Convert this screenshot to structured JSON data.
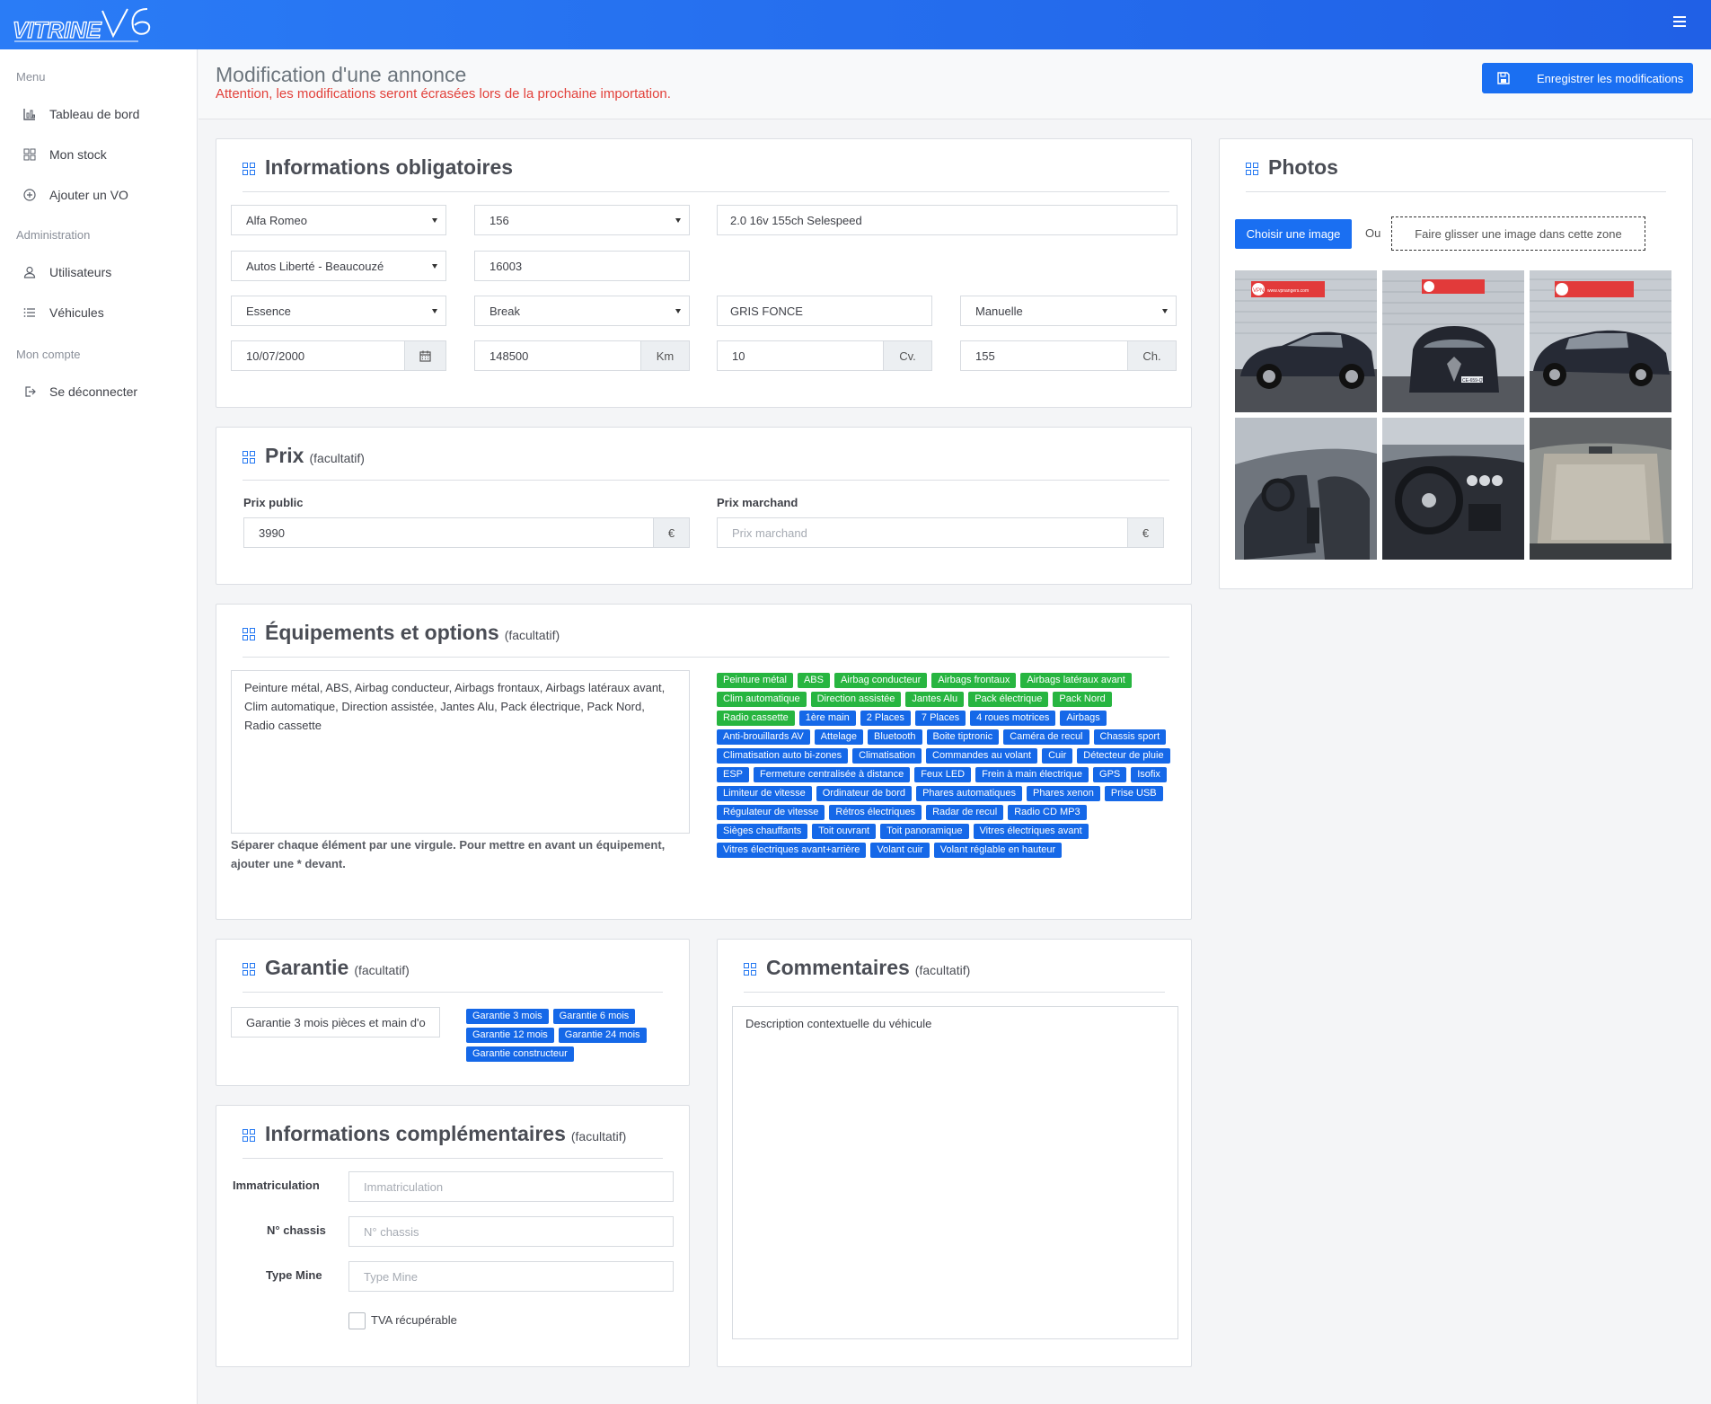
{
  "topbar": {
    "logo_text": "VITRINE",
    "logo_version": "V6"
  },
  "sidebar": {
    "sections": {
      "menu": "Menu",
      "admin": "Administration",
      "account": "Mon compte"
    },
    "items": [
      {
        "label": "Tableau de bord",
        "icon": "bar-chart-icon"
      },
      {
        "label": "Mon stock",
        "icon": "grid-icon"
      },
      {
        "label": "Ajouter un VO",
        "icon": "plus-circle-icon"
      },
      {
        "label": "Utilisateurs",
        "icon": "user-icon"
      },
      {
        "label": "Véhicules",
        "icon": "list-icon"
      },
      {
        "label": "Se déconnecter",
        "icon": "logout-icon"
      }
    ]
  },
  "header": {
    "title": "Modification d'une annonce",
    "warning": "Attention, les modifications seront écrasées lors de la prochaine importation.",
    "save_label": "Enregistrer les modifications"
  },
  "mandatory": {
    "title": "Informations obligatoires",
    "brand": "Alfa Romeo",
    "model": "156",
    "version": "2.0 16v 155ch Selespeed",
    "dealer": "Autos Liberté - Beaucouzé",
    "zip": "16003",
    "fuel": "Essence",
    "body": "Break",
    "color": "GRIS FONCE",
    "gearbox": "Manuelle",
    "date": "10/07/2000",
    "mileage": "148500",
    "mileage_unit": "Km",
    "fiscal_power": "10",
    "fiscal_unit": "Cv.",
    "power": "155",
    "power_unit": "Ch."
  },
  "price": {
    "title": "Prix",
    "optional": "(facultatif)",
    "public_label": "Prix public",
    "public_value": "3990",
    "merchant_label": "Prix marchand",
    "merchant_placeholder": "Prix marchand",
    "currency": "€"
  },
  "equipment": {
    "title": "Équipements et options",
    "optional": "(facultatif)",
    "text": "Peinture métal, ABS, Airbag conducteur, Airbags frontaux, Airbags latéraux avant, Clim automatique, Direction assistée, Jantes Alu, Pack électrique, Pack Nord, Radio cassette",
    "help": "Séparer chaque élément par une virgule. Pour mettre en avant un équipement, ajouter une * devant.",
    "selected_tags": [
      "Peinture métal",
      "ABS",
      "Airbag conducteur",
      "Airbags frontaux",
      "Airbags latéraux avant",
      "Clim automatique",
      "Direction assistée",
      "Jantes Alu",
      "Pack électrique",
      "Pack Nord",
      "Radio cassette"
    ],
    "available_tags": [
      "1ère main",
      "2 Places",
      "7 Places",
      "4 roues motrices",
      "Airbags",
      "Anti-brouillards AV",
      "Attelage",
      "Bluetooth",
      "Boite tiptronic",
      "Caméra de recul",
      "Chassis sport",
      "Climatisation auto bi-zones",
      "Climatisation",
      "Commandes au volant",
      "Cuir",
      "Détecteur de pluie",
      "ESP",
      "Fermeture centralisée à distance",
      "Feux LED",
      "Frein à main électrique",
      "GPS",
      "Isofix",
      "Limiteur de vitesse",
      "Ordinateur de bord",
      "Phares automatiques",
      "Phares xenon",
      "Prise USB",
      "Régulateur de vitesse",
      "Rétros électriques",
      "Radar de recul",
      "Radio CD MP3",
      "Sièges chauffants",
      "Toit ouvrant",
      "Toit panoramique",
      "Vitres électriques avant",
      "Vitres électriques avant+arrière",
      "Volant cuir",
      "Volant réglable en hauteur"
    ]
  },
  "warranty": {
    "title": "Garantie",
    "optional": "(facultatif)",
    "value": "Garantie 3 mois pièces et main d'o",
    "tags": [
      "Garantie 3 mois",
      "Garantie 6 mois",
      "Garantie 12 mois",
      "Garantie 24 mois",
      "Garantie constructeur"
    ]
  },
  "comments": {
    "title": "Commentaires",
    "optional": "(facultatif)",
    "placeholder": "Description contextuelle du véhicule"
  },
  "extra": {
    "title": "Informations complémentaires",
    "optional": "(facultatif)",
    "immat_label": "Immatriculation",
    "immat_placeholder": "Immatriculation",
    "chassis_label": "N° chassis",
    "chassis_placeholder": "N° chassis",
    "mine_label": "Type Mine",
    "mine_placeholder": "Type Mine",
    "vat_label": "TVA récupérable"
  },
  "photos": {
    "title": "Photos",
    "choose_label": "Choisir une image",
    "or_label": "Ou",
    "drop_label": "Faire glisser une image dans cette zone",
    "watermark": "VPN",
    "watermark_url": "www.vpnangers.com",
    "plate_text": "CE-659-QV"
  }
}
